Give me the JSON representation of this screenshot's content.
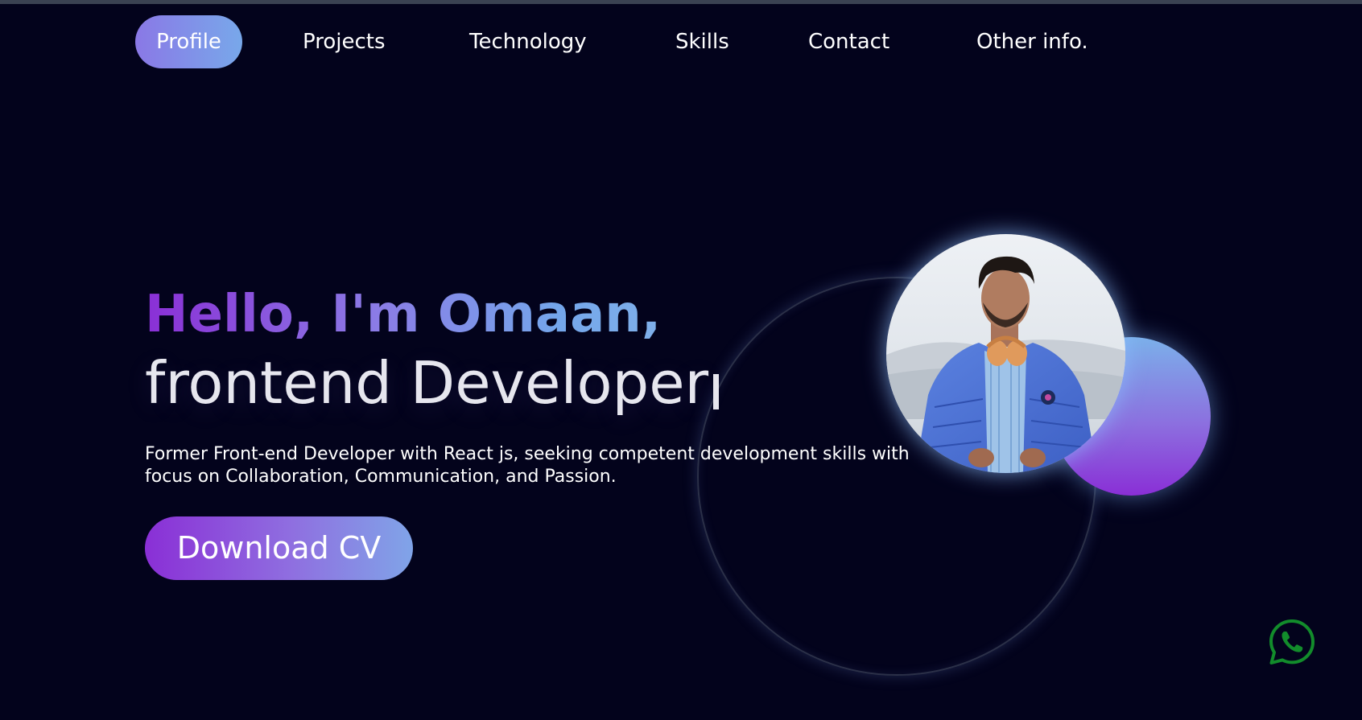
{
  "nav": {
    "items": [
      {
        "label": "Profile",
        "active": true
      },
      {
        "label": "Projects"
      },
      {
        "label": "Technology"
      },
      {
        "label": "Skills"
      },
      {
        "label": "Contact"
      },
      {
        "label": "Other info."
      }
    ]
  },
  "hero": {
    "greeting": "Hello, I'm Omaan,",
    "role": "frontend Developer",
    "description_line1": "Former Front-end Developer with React js, seeking competent development skills with",
    "description_line2": "focus on Collaboration, Communication, and Passion.",
    "cv_button_label": "Download CV"
  },
  "icons": {
    "whatsapp": "whatsapp-icon",
    "portrait": "profile-photo"
  },
  "colors": {
    "background": "#03031c",
    "accent_purple": "#8a2fd6",
    "accent_blue": "#78a8ea",
    "whatsapp_green": "#128c2b"
  }
}
